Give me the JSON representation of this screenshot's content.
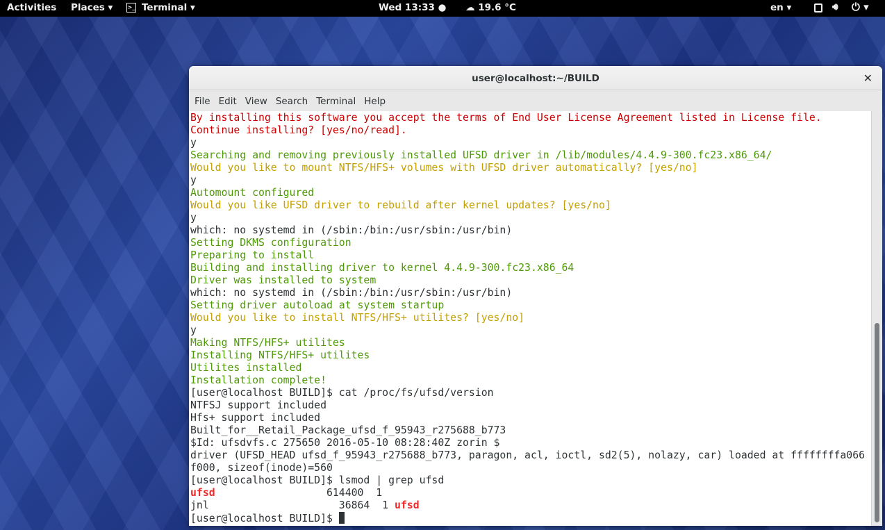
{
  "topbar": {
    "activities": "Activities",
    "places": "Places ▾",
    "terminal": "Terminal ▾",
    "clock": "Wed 13:33 ●",
    "weather": "☁ 19.6 °C",
    "lang": "en ▾",
    "icons": [
      "window-icon",
      "volume-icon",
      "power-icon"
    ]
  },
  "window": {
    "title": "user@localhost:~/BUILD",
    "close": "✕"
  },
  "menu": [
    "File",
    "Edit",
    "View",
    "Search",
    "Terminal",
    "Help"
  ],
  "colors": {
    "red": "#cc0000",
    "green": "#4e9a06",
    "yellow": "#c4a000",
    "text": "#2e3436"
  },
  "lines": [
    [
      [
        "red",
        "By installing this software you accept the terms of End User License Agreement listed in License file."
      ]
    ],
    [
      [
        "red",
        "Continue installing? [yes/no/read]."
      ]
    ],
    [
      [
        "",
        "y"
      ]
    ],
    [
      [
        "green",
        "Searching and removing previously installed UFSD driver in /lib/modules/4.4.9-300.fc23.x86_64/"
      ]
    ],
    [
      [
        "yellow",
        "Would you like to mount NTFS/HFS+ volumes with UFSD driver automatically? [yes/no]"
      ]
    ],
    [
      [
        "",
        "y"
      ]
    ],
    [
      [
        "green",
        "Automount configured"
      ]
    ],
    [
      [
        "yellow",
        "Would you like UFSD driver to rebuild after kernel updates? [yes/no]"
      ]
    ],
    [
      [
        "",
        "y"
      ]
    ],
    [
      [
        "",
        "which: no systemd in (/sbin:/bin:/usr/sbin:/usr/bin)"
      ]
    ],
    [
      [
        "green",
        "Setting DKMS configuration"
      ]
    ],
    [
      [
        "green",
        "Preparing to install"
      ]
    ],
    [
      [
        "green",
        "Building and installing driver to kernel 4.4.9-300.fc23.x86_64"
      ]
    ],
    [
      [
        "green",
        "Driver was installed to system"
      ]
    ],
    [
      [
        "",
        "which: no systemd in (/sbin:/bin:/usr/sbin:/usr/bin)"
      ]
    ],
    [
      [
        "green",
        "Setting driver autoload at system startup"
      ]
    ],
    [
      [
        "yellow",
        "Would you like to install NTFS/HFS+ utilites? [yes/no]"
      ]
    ],
    [
      [
        "",
        "y"
      ]
    ],
    [
      [
        "green",
        "Making NTFS/HFS+ utilites"
      ]
    ],
    [
      [
        "green",
        "Installing NTFS/HFS+ utilites"
      ]
    ],
    [
      [
        "green",
        "Utilites installed"
      ]
    ],
    [
      [
        "green",
        "Installation complete!"
      ]
    ],
    [
      [
        "",
        "[user@localhost BUILD]$ cat /proc/fs/ufsd/version"
      ]
    ],
    [
      [
        "",
        "NTFSJ support included"
      ]
    ],
    [
      [
        "",
        "Hfs+ support included"
      ]
    ],
    [
      [
        "",
        "Built_for__Retail_Package_ufsd_f_95943_r275688_b773"
      ]
    ],
    [
      [
        "",
        "$Id: ufsdvfs.c 275650 2016-05-10 08:28:40Z zorin $"
      ]
    ],
    [
      [
        "",
        "driver (UFSD_HEAD ufsd_f_95943_r275688_b773, paragon, acl, ioctl, sd2(5), nolazy, car) loaded at ffffffffa066"
      ]
    ],
    [
      [
        "",
        "f000, sizeof(inode)=560"
      ]
    ],
    [
      [
        "",
        "[user@localhost BUILD]$ lsmod | grep ufsd"
      ]
    ],
    [
      [
        "bred",
        "ufsd"
      ],
      [
        "",
        "                  614400  1"
      ]
    ],
    [
      [
        "",
        "jnl                     36864  1 "
      ],
      [
        "bred",
        "ufsd"
      ]
    ],
    [
      [
        "",
        "[user@localhost BUILD]$ "
      ]
    ]
  ]
}
